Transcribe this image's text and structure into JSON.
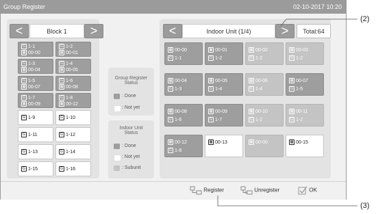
{
  "window": {
    "title": "Group Register",
    "datetime": "02-10-2017   10:20"
  },
  "left_nav": {
    "prev": "<",
    "label": "Block 1",
    "next": ">"
  },
  "groups": [
    {
      "g": "1-1",
      "u": "00-00",
      "state": "done"
    },
    {
      "g": "1-2",
      "u": "00-01",
      "state": "done"
    },
    {
      "g": "1-3",
      "u": "00-04",
      "state": "done"
    },
    {
      "g": "1-4",
      "u": "00-05",
      "state": "done"
    },
    {
      "g": "1-5",
      "u": "00-07",
      "state": "done"
    },
    {
      "g": "1-6",
      "u": "00-08",
      "state": "done"
    },
    {
      "g": "1-7",
      "u": "00-09",
      "state": "done"
    },
    {
      "g": "1-8",
      "u": "00-12",
      "state": "done"
    },
    {
      "g": "1-9",
      "u": "",
      "state": "notyet"
    },
    {
      "g": "1-10",
      "u": "",
      "state": "notyet"
    },
    {
      "g": "1-11",
      "u": "",
      "state": "notyet"
    },
    {
      "g": "1-12",
      "u": "",
      "state": "notyet"
    },
    {
      "g": "1-13",
      "u": "",
      "state": "notyet"
    },
    {
      "g": "1-14",
      "u": "",
      "state": "notyet"
    },
    {
      "g": "1-15",
      "u": "",
      "state": "notyet"
    },
    {
      "g": "1-16",
      "u": "",
      "state": "notyet"
    }
  ],
  "group_status": {
    "title_line1": "Group Register",
    "title_line2": "Status",
    "done": ": Done",
    "notyet": ": Not yet"
  },
  "unit_status": {
    "title_line1": "Indoor Unit",
    "title_line2": "Status",
    "done": ": Done",
    "notyet": ": Not yet",
    "subunit": ": Subunit"
  },
  "right_nav": {
    "prev": "<",
    "label": "Indoor Unit (1/4)",
    "next": ">",
    "total": "Total:64"
  },
  "units": [
    {
      "u": "00-00",
      "g": "1-1",
      "state": "done"
    },
    {
      "u": "00-01",
      "g": "1-2",
      "state": "done"
    },
    {
      "u": "00-02",
      "g": "1-2",
      "state": "subunit"
    },
    {
      "u": "00-03",
      "g": "1-2",
      "state": "subunit"
    },
    {
      "u": "00-04",
      "g": "1-3",
      "state": "done"
    },
    {
      "u": "00-05",
      "g": "1-4",
      "state": "done"
    },
    {
      "u": "00-06",
      "g": "1-4",
      "state": "subunit"
    },
    {
      "u": "00-07",
      "g": "1-5",
      "state": "done"
    },
    {
      "u": "00-08",
      "g": "1-6",
      "state": "done"
    },
    {
      "u": "00-09",
      "g": "1-7",
      "state": "done"
    },
    {
      "u": "00-10",
      "g": "1-2",
      "state": "subunit"
    },
    {
      "u": "00-11",
      "g": "1-2",
      "state": "subunit"
    },
    {
      "u": "00-12",
      "g": "1-8",
      "state": "done"
    },
    {
      "u": "00-13",
      "g": "",
      "state": "notyet"
    },
    {
      "u": "00-00",
      "g": "",
      "state": "subunit"
    },
    {
      "u": "00-15",
      "g": "",
      "state": "notyet"
    }
  ],
  "buttons": {
    "register": "Register",
    "unregister": "Unregister",
    "ok": "OK"
  },
  "callouts": {
    "c2": "(2)",
    "c3": "(3)"
  },
  "icons": {
    "group": "G",
    "unit": "unit-icon"
  },
  "colors": {
    "done": "#9e9e9e",
    "notyet": "#ffffff",
    "subunit": "#c4c4c4",
    "titlebar": "#9b9b9b"
  }
}
